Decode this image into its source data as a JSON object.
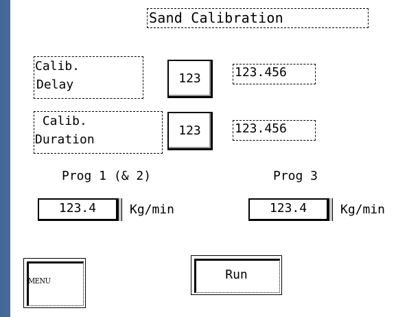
{
  "screen": {
    "title": "Sand Calibration"
  },
  "calib_delay": {
    "label_line1": "Calib.",
    "label_line2": "Delay",
    "input": "123",
    "readout": "123.456"
  },
  "calib_duration": {
    "label_line1": " Calib.",
    "label_line2": "Duration",
    "input": "123",
    "readout": "123.456"
  },
  "prog12": {
    "label": "Prog 1 (& 2)",
    "value": "123.4",
    "unit": "Kg/min"
  },
  "prog3": {
    "label": "Prog 3",
    "value": "123.4",
    "unit": "Kg/min"
  },
  "buttons": {
    "menu": "MENU",
    "run": "Run"
  },
  "colors": {
    "background_blue": "#5b82b4",
    "panel": "#ffffff"
  }
}
